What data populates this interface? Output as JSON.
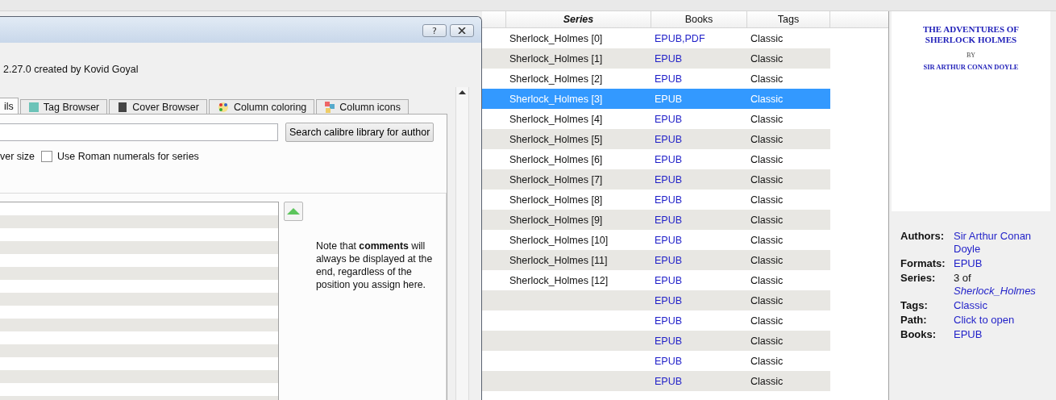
{
  "dialog": {
    "help_button": "?",
    "credit": "2.27.0 created by Kovid Goyal",
    "tabs": [
      {
        "label": "ils",
        "selected": true
      },
      {
        "label": "Tag Browser",
        "selected": false
      },
      {
        "label": "Cover Browser",
        "selected": false
      },
      {
        "label": "Column coloring",
        "selected": false
      },
      {
        "label": "Column icons",
        "selected": false
      }
    ],
    "search_button": "Search calibre library for author",
    "options": [
      {
        "kind": "text",
        "label": "ver size"
      },
      {
        "kind": "checkbox",
        "label": "Use Roman numerals for series",
        "checked": false
      }
    ],
    "note": "Note that **comments** will always be displayed at the end, regardless of the position you assign here."
  },
  "table": {
    "columns": [
      {
        "label": "Series",
        "sorted": true
      },
      {
        "label": "Books",
        "sorted": false
      },
      {
        "label": "Tags",
        "sorted": false
      }
    ],
    "rows": [
      {
        "series": "Sherlock_Holmes [0]",
        "books": "EPUB,PDF",
        "tags": "Classic",
        "selected": false
      },
      {
        "series": "Sherlock_Holmes [1]",
        "books": "EPUB",
        "tags": "Classic",
        "selected": false
      },
      {
        "series": "Sherlock_Holmes [2]",
        "books": "EPUB",
        "tags": "Classic",
        "selected": false
      },
      {
        "series": "Sherlock_Holmes [3]",
        "books": "EPUB",
        "tags": "Classic",
        "selected": true
      },
      {
        "series": "Sherlock_Holmes [4]",
        "books": "EPUB",
        "tags": "Classic",
        "selected": false
      },
      {
        "series": "Sherlock_Holmes [5]",
        "books": "EPUB",
        "tags": "Classic",
        "selected": false
      },
      {
        "series": "Sherlock_Holmes [6]",
        "books": "EPUB",
        "tags": "Classic",
        "selected": false
      },
      {
        "series": "Sherlock_Holmes [7]",
        "books": "EPUB",
        "tags": "Classic",
        "selected": false
      },
      {
        "series": "Sherlock_Holmes [8]",
        "books": "EPUB",
        "tags": "Classic",
        "selected": false
      },
      {
        "series": "Sherlock_Holmes [9]",
        "books": "EPUB",
        "tags": "Classic",
        "selected": false
      },
      {
        "series": "Sherlock_Holmes [10]",
        "books": "EPUB",
        "tags": "Classic",
        "selected": false
      },
      {
        "series": "Sherlock_Holmes [11]",
        "books": "EPUB",
        "tags": "Classic",
        "selected": false
      },
      {
        "series": "Sherlock_Holmes [12]",
        "books": "EPUB",
        "tags": "Classic",
        "selected": false
      },
      {
        "books": "EPUB",
        "tags": "Classic",
        "selected": false
      },
      {
        "books": "EPUB",
        "tags": "Classic",
        "selected": false
      },
      {
        "books": "EPUB",
        "tags": "Classic",
        "selected": false
      },
      {
        "books": "EPUB",
        "tags": "Classic",
        "selected": false
      },
      {
        "books": "EPUB",
        "tags": "Classic",
        "selected": false
      }
    ]
  },
  "details": {
    "cover": {
      "title": "THE ADVENTURES OF SHERLOCK HOLMES",
      "by": "BY",
      "author": "SIR ARTHUR CONAN DOYLE"
    },
    "fields": [
      {
        "kind": "link",
        "label": "Authors:",
        "value": "Sir Arthur Conan Doyle"
      },
      {
        "kind": "link",
        "label": "Formats:",
        "value": "EPUB"
      },
      {
        "kind": "series",
        "label": "Series:",
        "value": "3 of",
        "link": "Sherlock_Holmes"
      },
      {
        "kind": "link",
        "label": "Tags:",
        "value": "Classic"
      },
      {
        "kind": "link",
        "label": "Path:",
        "value": "Click to open"
      },
      {
        "kind": "link",
        "label": "Books:",
        "value": "EPUB"
      }
    ]
  }
}
